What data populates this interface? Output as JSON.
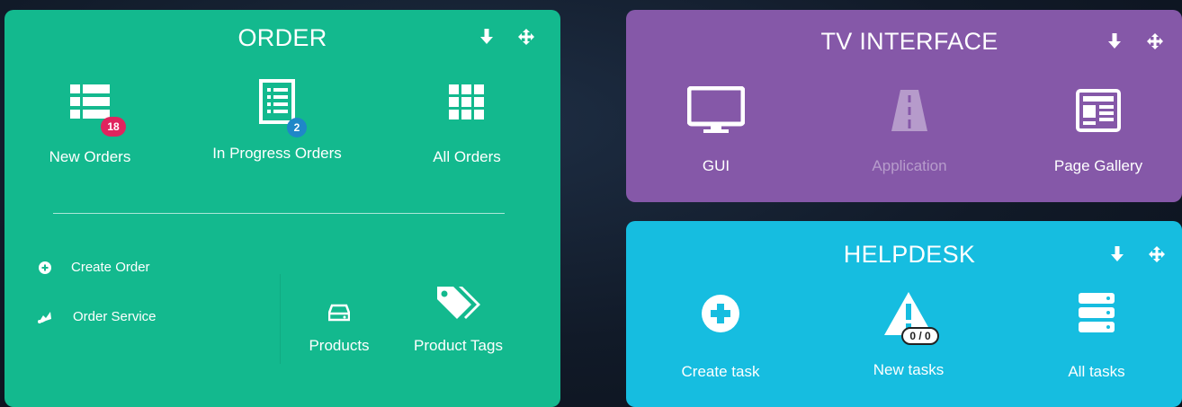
{
  "order": {
    "title": "ORDER",
    "tiles": [
      {
        "label": "New Orders",
        "badge": "18"
      },
      {
        "label": "In Progress Orders",
        "badge": "2"
      },
      {
        "label": "All Orders"
      }
    ],
    "links": [
      {
        "label": "Create Order"
      },
      {
        "label": "Order Service"
      }
    ],
    "bottom_tiles": [
      {
        "label": "Products"
      },
      {
        "label": "Product Tags"
      }
    ]
  },
  "tv": {
    "title": "TV INTERFACE",
    "tiles": [
      {
        "label": "GUI"
      },
      {
        "label": "Application"
      },
      {
        "label": "Page Gallery"
      }
    ]
  },
  "helpdesk": {
    "title": "HELPDESK",
    "tiles": [
      {
        "label": "Create task"
      },
      {
        "label": "New tasks",
        "badge": "0 / 0"
      },
      {
        "label": "All tasks"
      }
    ]
  },
  "colors": {
    "order_bg": "#13b98e",
    "tv_bg": "#8558a8",
    "helpdesk_bg": "#16bde0",
    "badge_red": "#e0245e",
    "badge_blue": "#1f87c8"
  }
}
